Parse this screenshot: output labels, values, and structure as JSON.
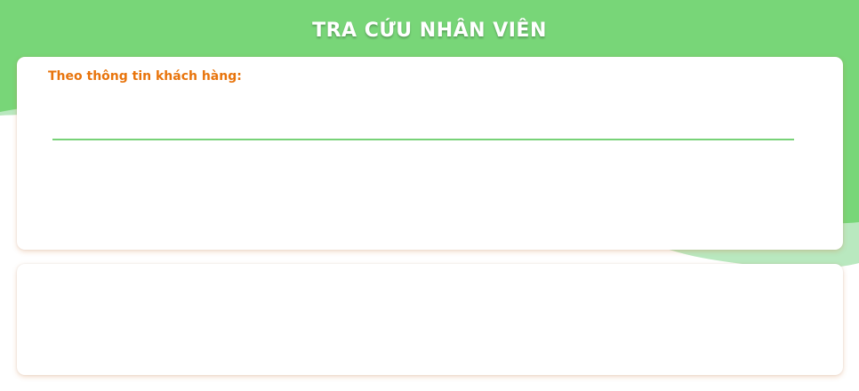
{
  "header": {
    "title": "TRA CỨU NHÂN VIÊN"
  },
  "search": {
    "label": "Theo thông tin khách hàng:",
    "value": "",
    "placeholder": ""
  },
  "colors": {
    "header_green": "#78d678",
    "accent_orange": "#e8740c",
    "input_underline": "#78d278"
  }
}
